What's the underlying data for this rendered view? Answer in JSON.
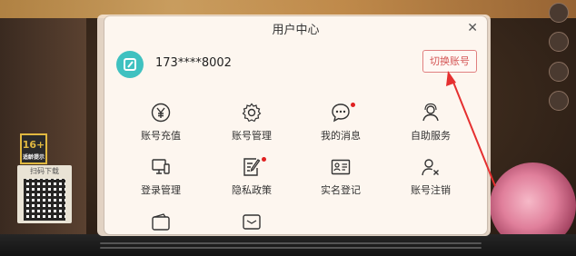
{
  "modal": {
    "title": "用户中心",
    "close_icon": "close-icon",
    "phone": "173****8002",
    "switch_label": "切换账号"
  },
  "menu": [
    {
      "label": "账号充值",
      "icon": "yen-icon"
    },
    {
      "label": "账号管理",
      "icon": "gear-icon"
    },
    {
      "label": "我的消息",
      "icon": "message-icon",
      "badge": true
    },
    {
      "label": "自助服务",
      "icon": "user-service-icon"
    },
    {
      "label": "登录管理",
      "icon": "devices-icon"
    },
    {
      "label": "隐私政策",
      "icon": "document-edit-icon",
      "badge": true
    },
    {
      "label": "实名登记",
      "icon": "id-card-icon"
    },
    {
      "label": "账号注销",
      "icon": "user-remove-icon"
    },
    {
      "label": "",
      "icon": "wallet-icon"
    },
    {
      "label": "",
      "icon": "mail-icon"
    }
  ],
  "qr": {
    "label": "扫码下载"
  },
  "age_badge": {
    "value": "16+",
    "caption": "适龄提示"
  },
  "colors": {
    "accent_red": "#d45555",
    "avatar": "#3fc1c0",
    "badge": "#e02020"
  }
}
